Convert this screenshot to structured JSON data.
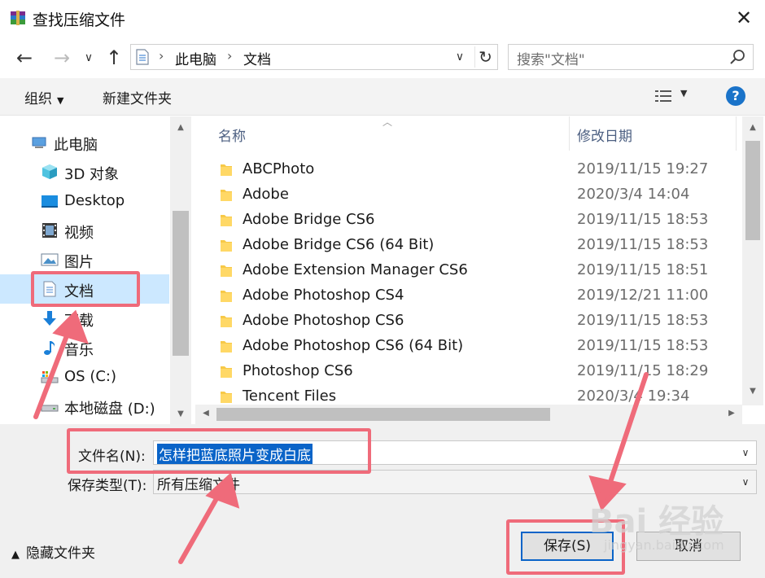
{
  "window": {
    "title": "查找压缩文件"
  },
  "address": {
    "crumbs": [
      "此电脑",
      "文档"
    ],
    "search_placeholder": "搜索\"文档\""
  },
  "toolbar": {
    "organize": "组织",
    "new_folder": "新建文件夹",
    "help": "?"
  },
  "nav": {
    "items": [
      {
        "label": "此电脑",
        "icon": "computer-icon"
      },
      {
        "label": "3D 对象",
        "icon": "cube-icon"
      },
      {
        "label": "Desktop",
        "icon": "desktop-icon"
      },
      {
        "label": "视频",
        "icon": "video-icon"
      },
      {
        "label": "图片",
        "icon": "picture-icon"
      },
      {
        "label": "文档",
        "icon": "document-icon",
        "selected": true
      },
      {
        "label": "下载",
        "icon": "download-icon"
      },
      {
        "label": "音乐",
        "icon": "music-icon"
      },
      {
        "label": "OS (C:)",
        "icon": "drive-icon"
      },
      {
        "label": "本地磁盘 (D:)",
        "icon": "disk-icon"
      }
    ]
  },
  "files": {
    "columns": {
      "name": "名称",
      "modified": "修改日期"
    },
    "rows": [
      {
        "name": "ABCPhoto",
        "date": "2019/11/15 19:27"
      },
      {
        "name": "Adobe",
        "date": "2020/3/4 14:04"
      },
      {
        "name": "Adobe Bridge CS6",
        "date": "2019/11/15 18:53"
      },
      {
        "name": "Adobe Bridge CS6 (64 Bit)",
        "date": "2019/11/15 18:53"
      },
      {
        "name": "Adobe Extension Manager CS6",
        "date": "2019/11/15 18:51"
      },
      {
        "name": "Adobe Photoshop CS4",
        "date": "2019/12/21 11:00"
      },
      {
        "name": "Adobe Photoshop CS6",
        "date": "2019/11/15 18:53"
      },
      {
        "name": "Adobe Photoshop CS6 (64 Bit)",
        "date": "2019/11/15 18:53"
      },
      {
        "name": "Photoshop CS6",
        "date": "2019/11/15 18:29"
      },
      {
        "name": "Tencent Files",
        "date": "2020/3/4 19:34"
      }
    ]
  },
  "form": {
    "filename_label": "文件名(N):",
    "filename_value": "怎样把蓝底照片变成白底",
    "type_label": "保存类型(T):",
    "type_value": "所有压缩文件",
    "hide_folders": "隐藏文件夹",
    "save": "保存(S)",
    "cancel": "取消"
  },
  "watermark": {
    "main": "Bai 经验",
    "sub": "jingyan.baidu.com"
  },
  "colors": {
    "accent": "#0a64c8",
    "annotation": "#ef6b7a",
    "selection": "#cce8ff"
  }
}
